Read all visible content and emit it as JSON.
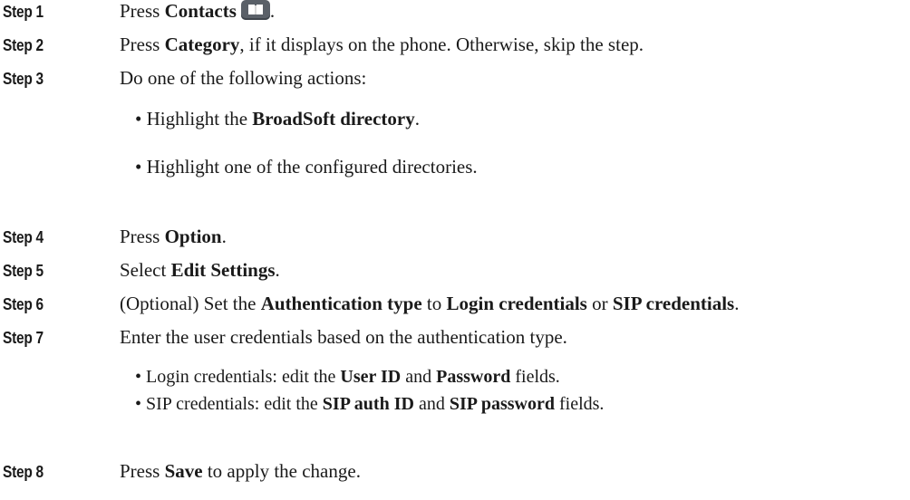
{
  "steps": [
    {
      "label": "Step 1",
      "parts": [
        "Press ",
        "Contacts",
        "."
      ]
    },
    {
      "label": "Step 2",
      "parts": [
        "Press ",
        "Category",
        ", if it displays on the phone. Otherwise, skip the step."
      ]
    },
    {
      "label": "Step 3",
      "text": "Do one of the following actions:",
      "bullets": [
        {
          "parts": [
            "• Highlight the ",
            "BroadSoft directory",
            "."
          ]
        },
        {
          "text": "• Highlight one of the configured directories."
        }
      ]
    },
    {
      "label": "Step 4",
      "parts": [
        "Press ",
        "Option",
        "."
      ]
    },
    {
      "label": "Step 5",
      "parts": [
        "Select ",
        "Edit Settings",
        "."
      ]
    },
    {
      "label": "Step 6",
      "parts": [
        "(Optional) Set the ",
        "Authentication type",
        " to ",
        "Login credentials",
        " or ",
        "SIP credentials",
        "."
      ]
    },
    {
      "label": "Step 7",
      "text": "Enter the user credentials based on the authentication type.",
      "bullets": [
        {
          "parts": [
            "• Login credentials: edit the ",
            "User ID",
            " and ",
            "Password",
            " fields."
          ]
        },
        {
          "parts": [
            "• SIP credentials: edit the ",
            "SIP auth ID",
            " and ",
            "SIP password",
            " fields."
          ]
        }
      ]
    },
    {
      "label": "Step 8",
      "parts": [
        "Press ",
        "Save",
        " to apply the change."
      ]
    }
  ],
  "icons": {
    "contacts": "contacts-book-icon"
  }
}
